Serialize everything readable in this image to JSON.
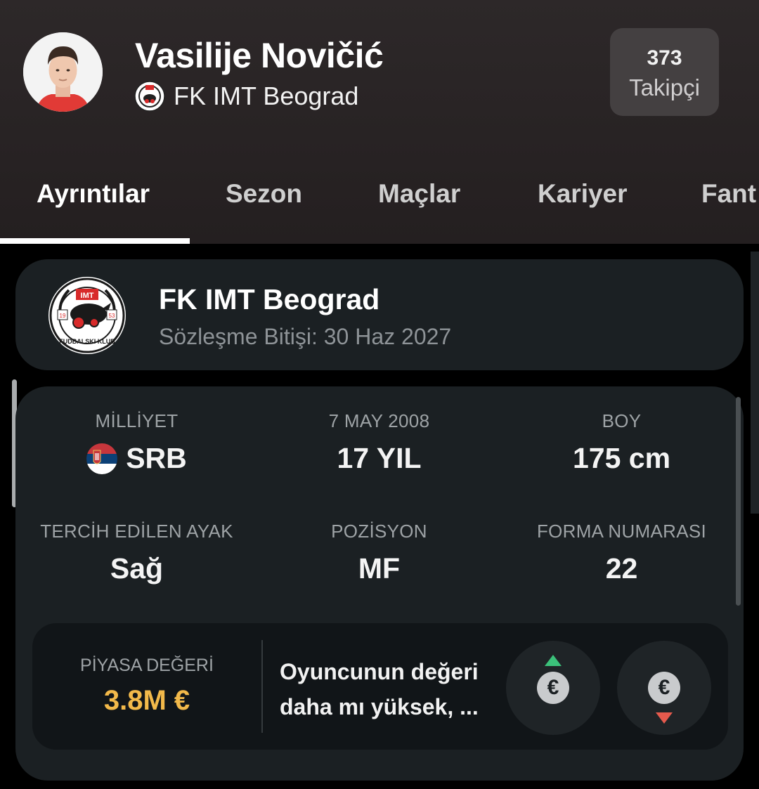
{
  "player": {
    "name": "Vasilije Novičić",
    "team": "FK IMT Beograd"
  },
  "follow": {
    "count": "373",
    "label": "Takipçi"
  },
  "tabs": [
    {
      "label": "Ayrıntılar",
      "active": true
    },
    {
      "label": "Sezon",
      "active": false
    },
    {
      "label": "Maçlar",
      "active": false
    },
    {
      "label": "Kariyer",
      "active": false
    },
    {
      "label": "Fant",
      "active": false
    }
  ],
  "club_card": {
    "name": "FK IMT Beograd",
    "contract": "Sözleşme Bitişi: 30 Haz 2027",
    "logo_text": {
      "top": "IMT",
      "year_left": "19",
      "year_right": "53",
      "bottom": "FUDBALSKI KLUB"
    }
  },
  "details": {
    "nationality": {
      "label": "MİLLİYET",
      "value": "SRB"
    },
    "birth": {
      "label": "7 MAY 2008",
      "value": "17 YIL"
    },
    "height": {
      "label": "BOY",
      "value": "175 cm"
    },
    "foot": {
      "label": "TERCİH EDİLEN AYAK",
      "value": "Sağ"
    },
    "position": {
      "label": "POZİSYON",
      "value": "MF"
    },
    "shirt": {
      "label": "FORMA NUMARASI",
      "value": "22"
    }
  },
  "market": {
    "label": "PİYASA DEĞERİ",
    "value": "3.8M €",
    "question_line1": "Oyuncunun değeri",
    "question_line2": "daha mı yüksek, ...",
    "euro_symbol": "€"
  },
  "colors": {
    "accent_gold": "#f2b94a",
    "up_green": "#3bc17a",
    "down_red": "#e55a4d"
  }
}
